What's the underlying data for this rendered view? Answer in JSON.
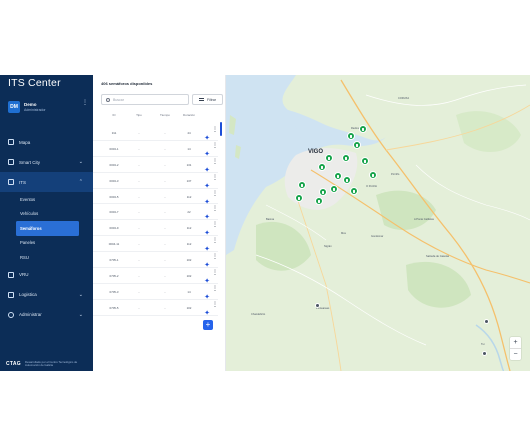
{
  "app": {
    "title": "ITS Center"
  },
  "user": {
    "initials": "DM",
    "name": "Demo",
    "role": "Administrador"
  },
  "menu": {
    "mapa": "Mapa",
    "smart_city": "Smart City",
    "its": "ITS",
    "its_children": [
      "Eventos",
      "Vehículos",
      "Semáforos",
      "Paneles",
      "RSU"
    ],
    "vru": "VRU",
    "logistica": "Logistica",
    "administrar": "Administrar"
  },
  "footer": {
    "logo": "CTAG",
    "text": "Desarrollado por el Centro Tecnológico de Automoción de Galicia"
  },
  "list": {
    "count_label": "406 semáforos disponibles",
    "search_placeholder": "Buscar",
    "filter_label": "Filtrar",
    "columns": [
      "ID",
      "Tipo",
      "Tiempo",
      "Duración"
    ],
    "rows": [
      [
        "311",
        "-",
        "-",
        "44"
      ],
      [
        "0004-1",
        "-",
        "-",
        "14"
      ],
      [
        "0004-2",
        "-",
        "-",
        "131"
      ],
      [
        "0004-3",
        "-",
        "-",
        "137"
      ],
      [
        "0004-5",
        "-",
        "-",
        "112"
      ],
      [
        "0004-7",
        "-",
        "-",
        "22"
      ],
      [
        "0004-9",
        "-",
        "-",
        "112"
      ],
      [
        "0004-11",
        "-",
        "-",
        "112"
      ],
      [
        "0705-1",
        "-",
        "-",
        "102"
      ],
      [
        "0705-2",
        "-",
        "-",
        "102"
      ],
      [
        "0705-3",
        "-",
        "-",
        "14"
      ],
      [
        "0705-5",
        "-",
        "-",
        "102"
      ]
    ]
  },
  "map": {
    "city": "VIGO",
    "places": [
      {
        "name": "CORUXA"
      },
      {
        "name": "Redondela"
      },
      {
        "name": "Mos"
      },
      {
        "name": "Porriño"
      },
      {
        "name": "O Porriño"
      },
      {
        "name": "Baiona"
      },
      {
        "name": "Nigrán"
      },
      {
        "name": "Gondomar"
      },
      {
        "name": "A Ponte Caldelas"
      },
      {
        "name": "Salceda de Caselas"
      },
      {
        "name": "Ponteareas"
      },
      {
        "name": "Tui"
      },
      {
        "name": "Chandebrito"
      }
    ],
    "colors": {
      "marker": "#16a34a",
      "sea": "#cfe3f2",
      "land": "#e4efd9"
    }
  }
}
